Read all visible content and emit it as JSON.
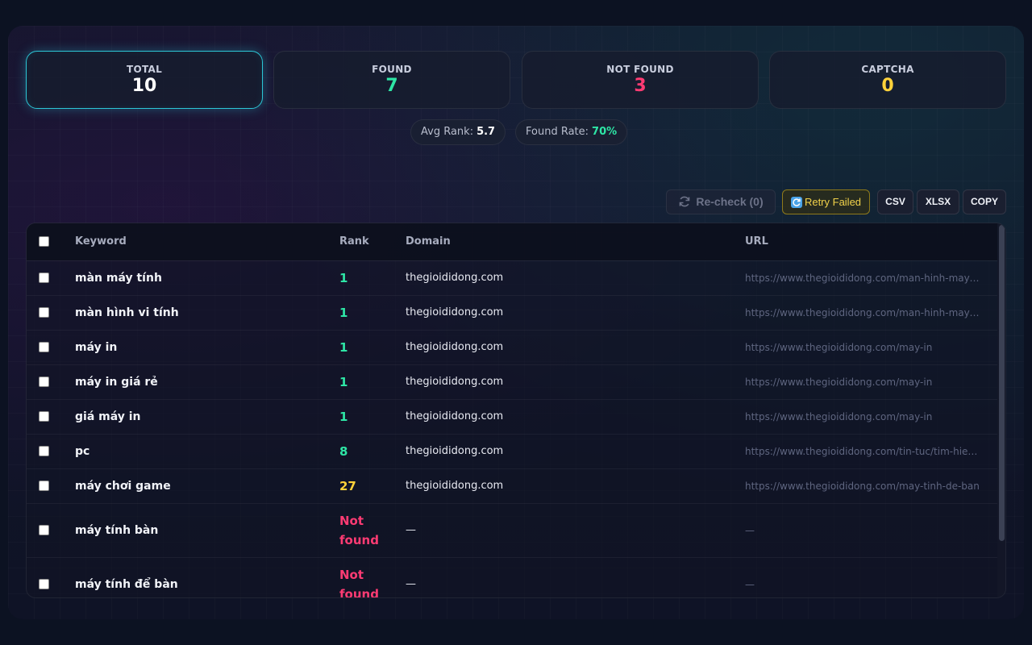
{
  "stats": [
    {
      "label": "TOTAL",
      "value": "10",
      "color": "#ffffff"
    },
    {
      "label": "FOUND",
      "value": "7",
      "color": "#2ee6a6"
    },
    {
      "label": "NOT FOUND",
      "value": "3",
      "color": "#ff3b73"
    },
    {
      "label": "CAPTCHA",
      "value": "0",
      "color": "#ffd23a"
    }
  ],
  "summary": {
    "avg_rank_label": "Avg Rank:",
    "avg_rank_value": "5.7",
    "found_rate_label": "Found Rate:",
    "found_rate_value": "70%"
  },
  "toolbar": {
    "recheck_label": "Re-check (0)",
    "retry_label": "Retry Failed",
    "csv_label": "CSV",
    "xlsx_label": "XLSX",
    "copy_label": "COPY"
  },
  "table": {
    "columns": {
      "keyword": "Keyword",
      "rank": "Rank",
      "domain": "Domain",
      "url": "URL"
    },
    "rows": [
      {
        "keyword": "màn máy tính",
        "rank": "1",
        "rank_color": "#2ee6a6",
        "domain": "thegioididong.com",
        "url": "https://www.thegioididong.com/man-hinh-may-tinh"
      },
      {
        "keyword": "màn hình vi tính",
        "rank": "1",
        "rank_color": "#2ee6a6",
        "domain": "thegioididong.com",
        "url": "https://www.thegioididong.com/man-hinh-may-tinh"
      },
      {
        "keyword": "máy in",
        "rank": "1",
        "rank_color": "#2ee6a6",
        "domain": "thegioididong.com",
        "url": "https://www.thegioididong.com/may-in"
      },
      {
        "keyword": "máy in giá rẻ",
        "rank": "1",
        "rank_color": "#2ee6a6",
        "domain": "thegioididong.com",
        "url": "https://www.thegioididong.com/may-in"
      },
      {
        "keyword": "giá máy in",
        "rank": "1",
        "rank_color": "#2ee6a6",
        "domain": "thegioididong.com",
        "url": "https://www.thegioididong.com/may-in"
      },
      {
        "keyword": "pc",
        "rank": "8",
        "rank_color": "#2ee6a6",
        "domain": "thegioididong.com",
        "url": "https://www.thegioididong.com/tin-tuc/tim-hieu-pc"
      },
      {
        "keyword": "máy chơi game",
        "rank": "27",
        "rank_color": "#ffd23a",
        "domain": "thegioididong.com",
        "url": "https://www.thegioididong.com/may-tinh-de-ban"
      },
      {
        "keyword": "máy tính bàn",
        "rank": "Not found",
        "rank_color": "#ff3b73",
        "domain": "—",
        "url": "—"
      },
      {
        "keyword": "máy tính để bàn",
        "rank": "Not found",
        "rank_color": "#ff3b73",
        "domain": "—",
        "url": "—"
      }
    ]
  }
}
